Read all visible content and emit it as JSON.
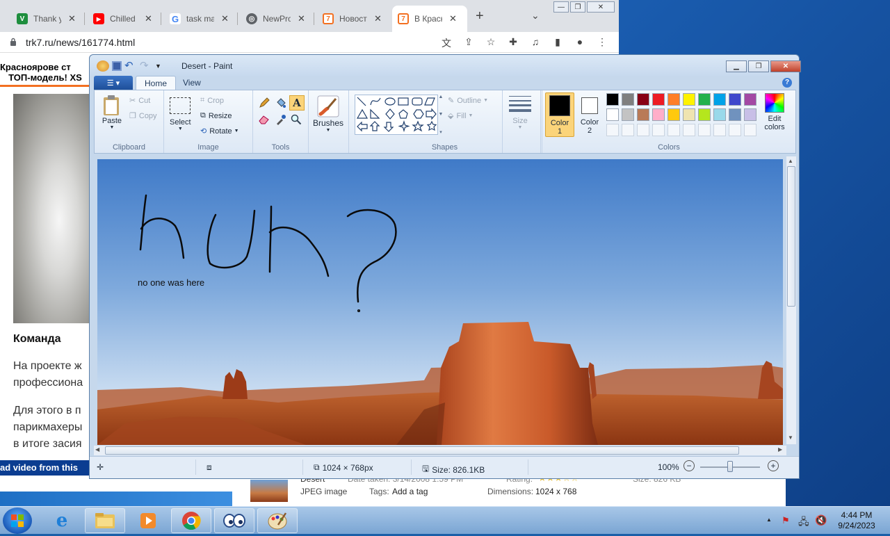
{
  "browser": {
    "tabs": [
      {
        "title": "Thank y",
        "fav": "V",
        "fav_color": "#1e8e3e"
      },
      {
        "title": "Chilled V",
        "fav": "▶",
        "fav_color": "#ff0000"
      },
      {
        "title": "task mar",
        "fav": "G",
        "fav_color": "#4285f4"
      },
      {
        "title": "NewProf",
        "fav": "◎",
        "fav_color": "#5f6368"
      },
      {
        "title": "Новости",
        "fav": "7",
        "fav_color": "#f37021"
      },
      {
        "title": "В Красн",
        "fav": "7",
        "fav_color": "#f37021"
      }
    ],
    "url": "trk7.ru/news/161774.html",
    "page": {
      "headline_1": "Красноярове ст",
      "headline_2": "ТОП-модель! XS",
      "section_heading": "Команда",
      "para_1a": "На проекте ж",
      "para_1b": "профессиона",
      "para_2a": "Для этого в п",
      "para_2b": "парикмахеры",
      "para_2c": "в итоге засия",
      "video_bar": "ad video from this"
    }
  },
  "paint": {
    "window_title": "Desert - Paint",
    "tabs": {
      "home": "Home",
      "view": "View"
    },
    "clipboard": {
      "paste": "Paste",
      "cut": "Cut",
      "copy": "Copy",
      "label": "Clipboard"
    },
    "image": {
      "select": "Select",
      "crop": "Crop",
      "resize": "Resize",
      "rotate": "Rotate",
      "label": "Image"
    },
    "tools": {
      "label": "Tools"
    },
    "brushes": {
      "label": "Brushes"
    },
    "shapes": {
      "outline": "Outline",
      "fill": "Fill",
      "label": "Shapes"
    },
    "size": {
      "label": "Size"
    },
    "colors": {
      "color1": "Color 1",
      "color1_a": "Color",
      "color1_b": "1",
      "color2_a": "Color",
      "color2_b": "2",
      "edit_a": "Edit",
      "edit_b": "colors",
      "label": "Colors",
      "color1_value": "#000000",
      "color2_value": "#ffffff",
      "palette_row1": [
        "#000000",
        "#7f7f7f",
        "#880015",
        "#ed1c24",
        "#ff7f27",
        "#fff200",
        "#22b14c",
        "#00a2e8",
        "#3f48cc",
        "#a349a4"
      ],
      "palette_row2": [
        "#ffffff",
        "#c3c3c3",
        "#b97a57",
        "#ffaec9",
        "#ffc90e",
        "#efe4b0",
        "#b5e61d",
        "#99d9ea",
        "#7092be",
        "#c8bfe7"
      ]
    },
    "canvas": {
      "drawn_text": "no one was here"
    },
    "status": {
      "dimensions": "1024 × 768px",
      "size": "Size: 826.1KB",
      "zoom": "100%",
      "zoom_fraction": 0.5
    }
  },
  "explorer": {
    "name": "Desert",
    "date_taken": "Date taken: 3/14/2008 1:59 PM",
    "rating": "Rating:",
    "size": "Size: 826 KB",
    "type": "JPEG image",
    "tags_label": "Tags:",
    "tags_value": "Add a tag",
    "dimensions_label": "Dimensions:",
    "dimensions_value": "1024 x 768"
  },
  "taskbar": {
    "time": "4:44 PM",
    "date": "9/24/2023"
  }
}
